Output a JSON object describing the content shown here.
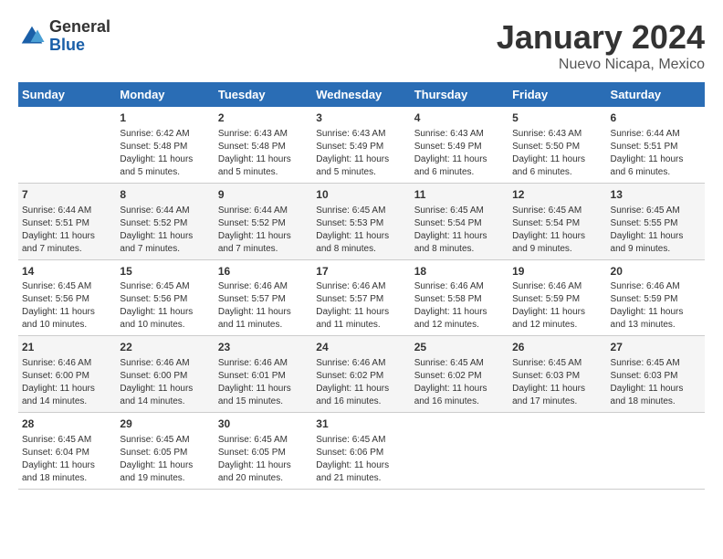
{
  "header": {
    "logo_general": "General",
    "logo_blue": "Blue",
    "main_title": "January 2024",
    "subtitle": "Nuevo Nicapa, Mexico"
  },
  "days_of_week": [
    "Sunday",
    "Monday",
    "Tuesday",
    "Wednesday",
    "Thursday",
    "Friday",
    "Saturday"
  ],
  "weeks": [
    [
      {
        "day": "",
        "lines": []
      },
      {
        "day": "1",
        "lines": [
          "Sunrise: 6:42 AM",
          "Sunset: 5:48 PM",
          "Daylight: 11 hours",
          "and 5 minutes."
        ]
      },
      {
        "day": "2",
        "lines": [
          "Sunrise: 6:43 AM",
          "Sunset: 5:48 PM",
          "Daylight: 11 hours",
          "and 5 minutes."
        ]
      },
      {
        "day": "3",
        "lines": [
          "Sunrise: 6:43 AM",
          "Sunset: 5:49 PM",
          "Daylight: 11 hours",
          "and 5 minutes."
        ]
      },
      {
        "day": "4",
        "lines": [
          "Sunrise: 6:43 AM",
          "Sunset: 5:49 PM",
          "Daylight: 11 hours",
          "and 6 minutes."
        ]
      },
      {
        "day": "5",
        "lines": [
          "Sunrise: 6:43 AM",
          "Sunset: 5:50 PM",
          "Daylight: 11 hours",
          "and 6 minutes."
        ]
      },
      {
        "day": "6",
        "lines": [
          "Sunrise: 6:44 AM",
          "Sunset: 5:51 PM",
          "Daylight: 11 hours",
          "and 6 minutes."
        ]
      }
    ],
    [
      {
        "day": "7",
        "lines": [
          "Sunrise: 6:44 AM",
          "Sunset: 5:51 PM",
          "Daylight: 11 hours",
          "and 7 minutes."
        ]
      },
      {
        "day": "8",
        "lines": [
          "Sunrise: 6:44 AM",
          "Sunset: 5:52 PM",
          "Daylight: 11 hours",
          "and 7 minutes."
        ]
      },
      {
        "day": "9",
        "lines": [
          "Sunrise: 6:44 AM",
          "Sunset: 5:52 PM",
          "Daylight: 11 hours",
          "and 7 minutes."
        ]
      },
      {
        "day": "10",
        "lines": [
          "Sunrise: 6:45 AM",
          "Sunset: 5:53 PM",
          "Daylight: 11 hours",
          "and 8 minutes."
        ]
      },
      {
        "day": "11",
        "lines": [
          "Sunrise: 6:45 AM",
          "Sunset: 5:54 PM",
          "Daylight: 11 hours",
          "and 8 minutes."
        ]
      },
      {
        "day": "12",
        "lines": [
          "Sunrise: 6:45 AM",
          "Sunset: 5:54 PM",
          "Daylight: 11 hours",
          "and 9 minutes."
        ]
      },
      {
        "day": "13",
        "lines": [
          "Sunrise: 6:45 AM",
          "Sunset: 5:55 PM",
          "Daylight: 11 hours",
          "and 9 minutes."
        ]
      }
    ],
    [
      {
        "day": "14",
        "lines": [
          "Sunrise: 6:45 AM",
          "Sunset: 5:56 PM",
          "Daylight: 11 hours",
          "and 10 minutes."
        ]
      },
      {
        "day": "15",
        "lines": [
          "Sunrise: 6:45 AM",
          "Sunset: 5:56 PM",
          "Daylight: 11 hours",
          "and 10 minutes."
        ]
      },
      {
        "day": "16",
        "lines": [
          "Sunrise: 6:46 AM",
          "Sunset: 5:57 PM",
          "Daylight: 11 hours",
          "and 11 minutes."
        ]
      },
      {
        "day": "17",
        "lines": [
          "Sunrise: 6:46 AM",
          "Sunset: 5:57 PM",
          "Daylight: 11 hours",
          "and 11 minutes."
        ]
      },
      {
        "day": "18",
        "lines": [
          "Sunrise: 6:46 AM",
          "Sunset: 5:58 PM",
          "Daylight: 11 hours",
          "and 12 minutes."
        ]
      },
      {
        "day": "19",
        "lines": [
          "Sunrise: 6:46 AM",
          "Sunset: 5:59 PM",
          "Daylight: 11 hours",
          "and 12 minutes."
        ]
      },
      {
        "day": "20",
        "lines": [
          "Sunrise: 6:46 AM",
          "Sunset: 5:59 PM",
          "Daylight: 11 hours",
          "and 13 minutes."
        ]
      }
    ],
    [
      {
        "day": "21",
        "lines": [
          "Sunrise: 6:46 AM",
          "Sunset: 6:00 PM",
          "Daylight: 11 hours",
          "and 14 minutes."
        ]
      },
      {
        "day": "22",
        "lines": [
          "Sunrise: 6:46 AM",
          "Sunset: 6:00 PM",
          "Daylight: 11 hours",
          "and 14 minutes."
        ]
      },
      {
        "day": "23",
        "lines": [
          "Sunrise: 6:46 AM",
          "Sunset: 6:01 PM",
          "Daylight: 11 hours",
          "and 15 minutes."
        ]
      },
      {
        "day": "24",
        "lines": [
          "Sunrise: 6:46 AM",
          "Sunset: 6:02 PM",
          "Daylight: 11 hours",
          "and 16 minutes."
        ]
      },
      {
        "day": "25",
        "lines": [
          "Sunrise: 6:45 AM",
          "Sunset: 6:02 PM",
          "Daylight: 11 hours",
          "and 16 minutes."
        ]
      },
      {
        "day": "26",
        "lines": [
          "Sunrise: 6:45 AM",
          "Sunset: 6:03 PM",
          "Daylight: 11 hours",
          "and 17 minutes."
        ]
      },
      {
        "day": "27",
        "lines": [
          "Sunrise: 6:45 AM",
          "Sunset: 6:03 PM",
          "Daylight: 11 hours",
          "and 18 minutes."
        ]
      }
    ],
    [
      {
        "day": "28",
        "lines": [
          "Sunrise: 6:45 AM",
          "Sunset: 6:04 PM",
          "Daylight: 11 hours",
          "and 18 minutes."
        ]
      },
      {
        "day": "29",
        "lines": [
          "Sunrise: 6:45 AM",
          "Sunset: 6:05 PM",
          "Daylight: 11 hours",
          "and 19 minutes."
        ]
      },
      {
        "day": "30",
        "lines": [
          "Sunrise: 6:45 AM",
          "Sunset: 6:05 PM",
          "Daylight: 11 hours",
          "and 20 minutes."
        ]
      },
      {
        "day": "31",
        "lines": [
          "Sunrise: 6:45 AM",
          "Sunset: 6:06 PM",
          "Daylight: 11 hours",
          "and 21 minutes."
        ]
      },
      {
        "day": "",
        "lines": []
      },
      {
        "day": "",
        "lines": []
      },
      {
        "day": "",
        "lines": []
      }
    ]
  ]
}
